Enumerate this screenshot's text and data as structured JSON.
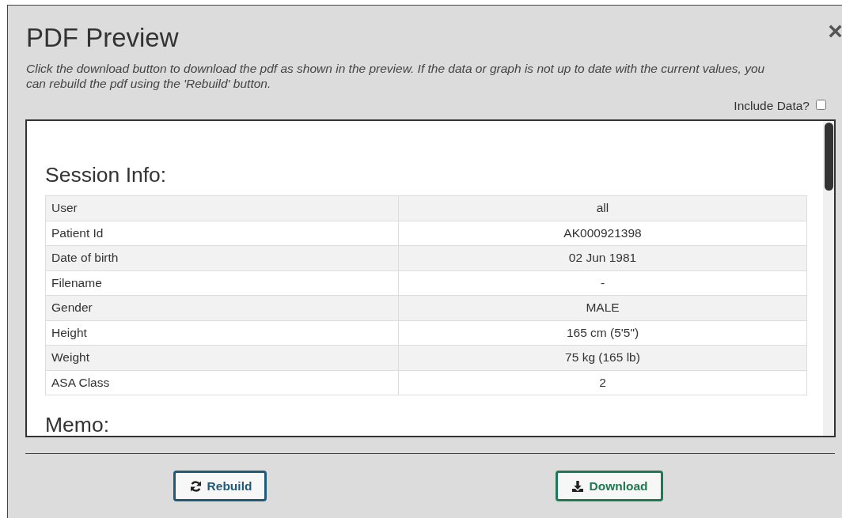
{
  "dialog": {
    "title": "PDF Preview",
    "close": "×",
    "description": "Click the download button to download the pdf as shown in the preview. If the data or graph is not up to date with the current values, you can rebuild the pdf using the 'Rebuild' button.",
    "include_data": {
      "label": "Include Data?",
      "checked": false
    }
  },
  "preview": {
    "sections": [
      {
        "heading": "Session Info:",
        "rows": [
          {
            "label": "User",
            "value": "all"
          },
          {
            "label": "Patient Id",
            "value": "AK000921398"
          },
          {
            "label": "Date of birth",
            "value": "02 Jun 1981"
          },
          {
            "label": "Filename",
            "value": "-"
          },
          {
            "label": "Gender",
            "value": "MALE"
          },
          {
            "label": "Height",
            "value": "165 cm (5'5\")"
          },
          {
            "label": "Weight",
            "value": "75 kg (165 lb)"
          },
          {
            "label": "ASA Class",
            "value": "2"
          }
        ]
      },
      {
        "heading": "Memo:"
      }
    ]
  },
  "buttons": [
    {
      "kind": "rebuild",
      "label": "Rebuild"
    },
    {
      "kind": "download",
      "label": "Download"
    }
  ]
}
